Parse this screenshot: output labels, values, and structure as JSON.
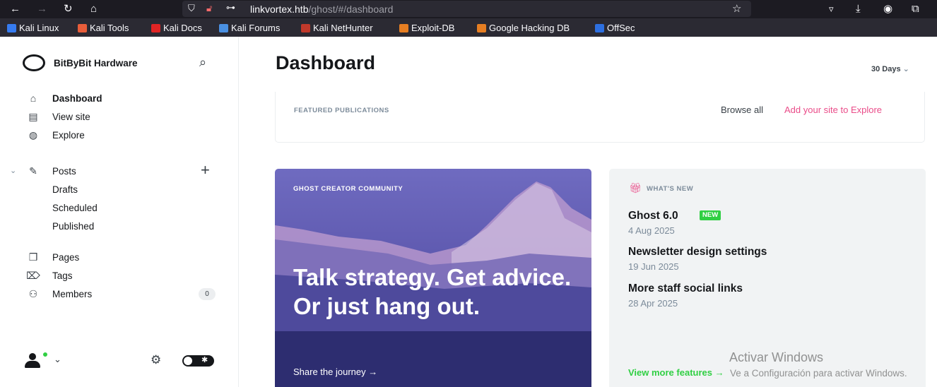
{
  "browser": {
    "url_host": "linkvortex.htb",
    "url_path": "/ghost/#/dashboard",
    "bookmarks": [
      {
        "label": "Kali Linux",
        "color": "#367bf0"
      },
      {
        "label": "Kali Tools",
        "color": "#e85d3a"
      },
      {
        "label": "Kali Docs",
        "color": "#e02424"
      },
      {
        "label": "Kali Forums",
        "color": "#4a90e2"
      },
      {
        "label": "Kali NetHunter",
        "color": "#c0392b"
      },
      {
        "label": "Exploit-DB",
        "color": "#e67e22"
      },
      {
        "label": "Google Hacking DB",
        "color": "#e67e22"
      },
      {
        "label": "OffSec",
        "color": "#2d6fe0"
      }
    ]
  },
  "sidebar": {
    "brand": "BitByBit Hardware",
    "nav": [
      {
        "label": "Dashboard",
        "icon": "home-icon"
      },
      {
        "label": "View site",
        "icon": "browser-icon"
      },
      {
        "label": "Explore",
        "icon": "globe-icon"
      }
    ],
    "posts": {
      "label": "Posts",
      "sub": [
        "Drafts",
        "Scheduled",
        "Published"
      ]
    },
    "more": [
      {
        "label": "Pages",
        "icon": "pages-icon"
      },
      {
        "label": "Tags",
        "icon": "tag-icon"
      },
      {
        "label": "Members",
        "icon": "members-icon"
      }
    ],
    "members_count": "0"
  },
  "main": {
    "title": "Dashboard",
    "range": "30 Days",
    "featured": {
      "label": "FEATURED PUBLICATIONS",
      "browse_all": "Browse all",
      "add_site": "Add your site to Explore"
    },
    "community": {
      "label": "GHOST CREATOR COMMUNITY",
      "headline_1": "Talk strategy. Get advice.",
      "headline_2": "Or just hang out.",
      "link": "Share the journey →"
    },
    "whats_new": {
      "label": "WHAT'S NEW",
      "new_badge": "NEW",
      "items": [
        {
          "title": "Ghost 6.0",
          "date": "4 Aug 2025"
        },
        {
          "title": "Newsletter design settings",
          "date": "19 Jun 2025"
        },
        {
          "title": "More staff social links",
          "date": "28 Apr 2025"
        }
      ],
      "more": "View more features →"
    }
  },
  "watermark": {
    "title": "Activar Windows",
    "sub": "Ve a Configuración para activar Windows."
  }
}
